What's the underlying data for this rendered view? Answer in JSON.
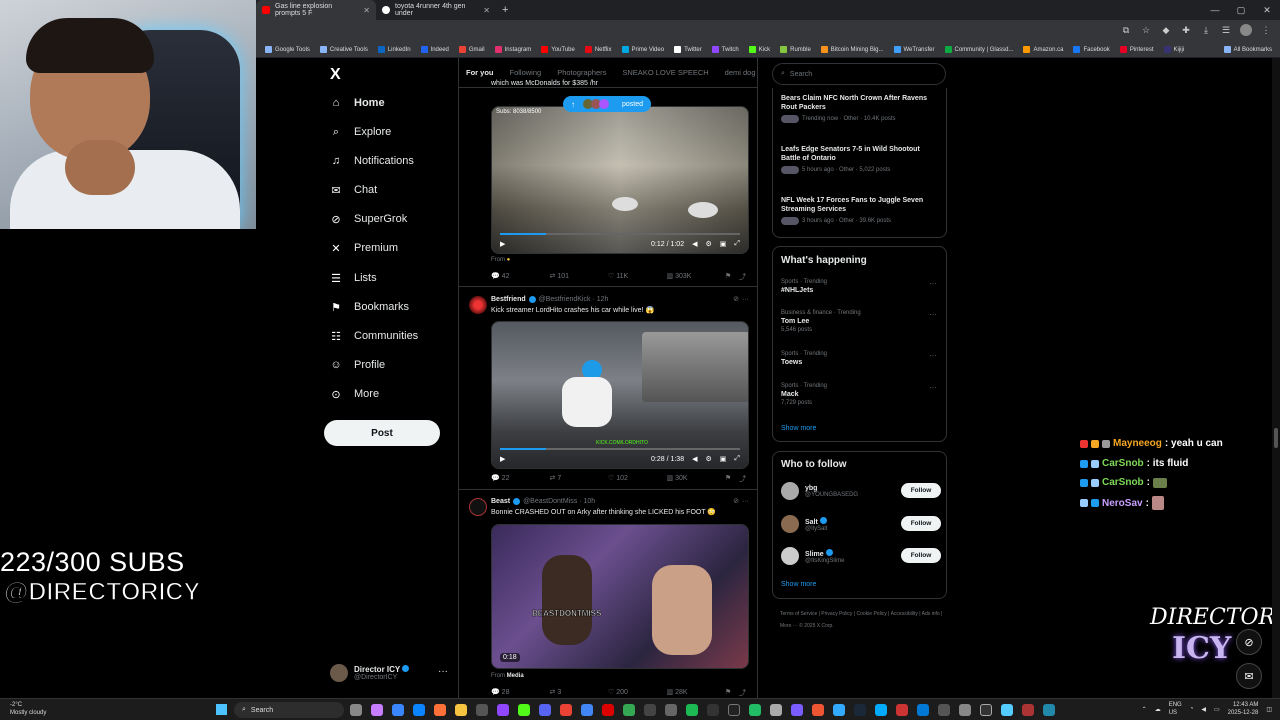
{
  "browser": {
    "tabs": [
      {
        "title": "Gas line explosion prompts 5 F",
        "fav_color": "#ff0000"
      },
      {
        "title": "toyota 4runner 4th gen under",
        "fav_color": "#ffffff"
      }
    ],
    "bookmarks": [
      "Google Tools",
      "Creative Tools",
      "LinkedIn",
      "Indeed",
      "Gmail",
      "Instagram",
      "YouTube",
      "Netflix",
      "Prime Video",
      "Twitter",
      "Twitch",
      "Kick",
      "Rumble",
      "Bitcoin Mining Big...",
      "WeTransfer",
      "Community | Glassd...",
      "Amazon.ca",
      "Facebook",
      "Pinterest",
      "Kijiji"
    ],
    "all_bookmarks": "All Bookmarks"
  },
  "stream": {
    "subs": "223/300 SUBS",
    "handle": "@DIRECTORICY",
    "logo_top": "DIRECTOR",
    "logo_bottom": "ICY"
  },
  "nav": {
    "logo": "X",
    "items": [
      {
        "label": "Home",
        "icon": "home-icon"
      },
      {
        "label": "Explore",
        "icon": "search-icon"
      },
      {
        "label": "Notifications",
        "icon": "bell-icon"
      },
      {
        "label": "Chat",
        "icon": "mail-icon"
      },
      {
        "label": "SuperGrok",
        "icon": "grok-icon"
      },
      {
        "label": "Premium",
        "icon": "x-icon"
      },
      {
        "label": "Lists",
        "icon": "list-icon"
      },
      {
        "label": "Bookmarks",
        "icon": "bookmark-icon"
      },
      {
        "label": "Communities",
        "icon": "communities-icon"
      },
      {
        "label": "Profile",
        "icon": "person-icon"
      },
      {
        "label": "More",
        "icon": "more-icon"
      }
    ],
    "post_label": "Post",
    "account_name": "Director ICY",
    "account_handle": "@DirectorICY"
  },
  "feed": {
    "tabs": [
      "For you",
      "Following",
      "Photographers",
      "SNEAKO LOVE SPEECH",
      "demi dog"
    ],
    "posted_pill": "posted",
    "tweet1": {
      "text": "which was McDonalds for $385 /hr",
      "time": "0:12 / 1:02",
      "overlay": "Subs: 8038/8500",
      "from": "From",
      "replies": "42",
      "reposts": "101",
      "likes": "11K",
      "views": "303K"
    },
    "tweet2": {
      "name": "Bestfriend",
      "handle": "@BestfriendKick · 12h",
      "text": "Kick streamer LordHito crashes his car while live! 😱",
      "time": "0:28 / 1:38",
      "watermark": "KICK.COM/LORDHITO",
      "replies": "22",
      "reposts": "7",
      "likes": "102",
      "views": "30K"
    },
    "tweet3": {
      "name": "Beast",
      "handle": "@BeastDontMiss · 10h",
      "text": "Bonnie CRASHED OUT on Arky after thinking she LICKED his FOOT 😳",
      "time": "0:18",
      "watermark": "BEASTDONTMISS",
      "from": "From",
      "from_link": "Media",
      "replies": "28",
      "reposts": "3",
      "likes": "200",
      "views": "28K"
    }
  },
  "right": {
    "search_placeholder": "Search",
    "news": [
      {
        "title": "Bears Claim NFC North Crown After Ravens Rout Packers",
        "meta": "Trending now · Other · 10.4K posts"
      },
      {
        "title": "Leafs Edge Senators 7-5 in Wild Shootout Battle of Ontario",
        "meta": "5 hours ago · Other · 5,022 posts"
      },
      {
        "title": "NFL Week 17 Forces Fans to Juggle Seven Streaming Services",
        "meta": "3 hours ago · Other · 39.6K posts"
      }
    ],
    "happening_title": "What's happening",
    "trends": [
      {
        "context": "Sports · Trending",
        "name": "#NHLJets",
        "posts": ""
      },
      {
        "context": "Business & finance · Trending",
        "name": "Tom Lee",
        "posts": "5,546 posts"
      },
      {
        "context": "Sports · Trending",
        "name": "Toews",
        "posts": ""
      },
      {
        "context": "Sports · Trending",
        "name": "Mack",
        "posts": "7,729 posts"
      }
    ],
    "show_more": "Show more",
    "wtf_title": "Who to follow",
    "follow_label": "Follow",
    "wtf": [
      {
        "name": "ybg",
        "handle": "@YOUNGBASEDG"
      },
      {
        "name": "Salt",
        "handle": "@IlySalt"
      },
      {
        "name": "Slime",
        "handle": "@ItsKingSlime"
      }
    ],
    "footer": "Terms of Service | Privacy Policy | Cookie Policy | Accessibility | Ads info | More ··· © 2025 X Corp."
  },
  "chat": [
    {
      "user": "Mayneeog",
      "color": "#f5a623",
      "msg": ": yeah u can"
    },
    {
      "user": "CarSnob",
      "color": "#7ed957",
      "msg": ": its fluid"
    },
    {
      "user": "CarSnob",
      "color": "#7ed957",
      "msg": ":"
    },
    {
      "user": "NeroSav",
      "color": "#c9a0ff",
      "msg": ":"
    }
  ],
  "taskbar": {
    "temp": "-2°C",
    "weather": "Mostly cloudy",
    "search": "Search",
    "lang1": "ENG",
    "lang2": "US",
    "time": "12:43 AM",
    "date": "2025-12-28"
  }
}
